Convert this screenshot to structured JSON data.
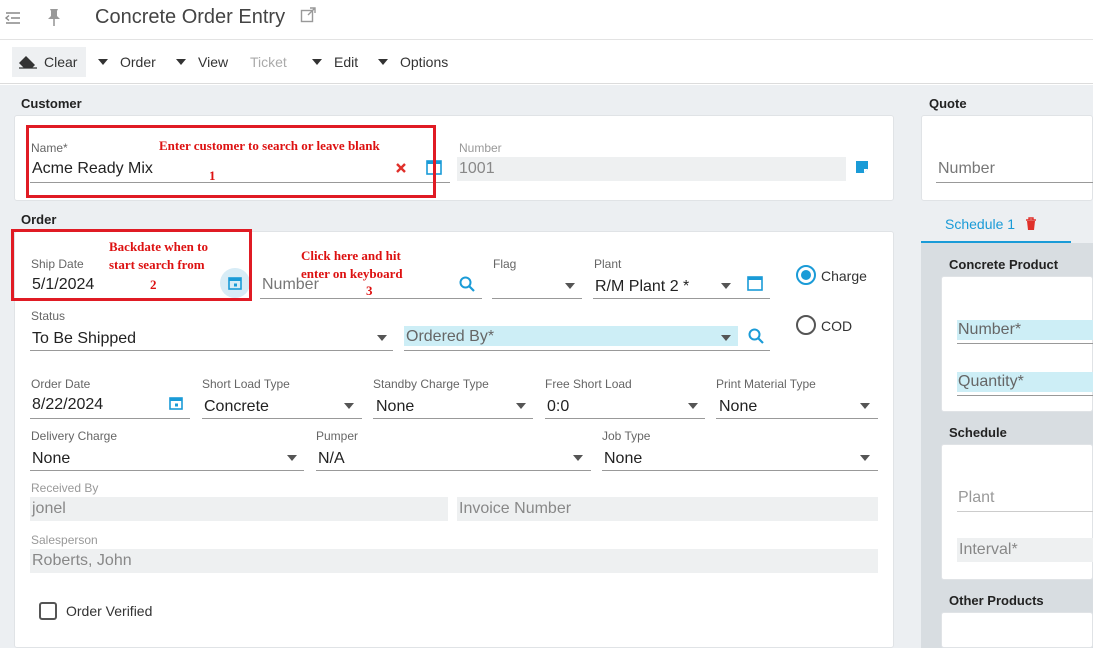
{
  "app": {
    "title": "Concrete Order Entry"
  },
  "toolbar": {
    "clear": "Clear",
    "order": "Order",
    "view": "View",
    "ticket": "Ticket",
    "edit": "Edit",
    "options": "Options"
  },
  "customer": {
    "section": "Customer",
    "name_label": "Name*",
    "name_value": "Acme Ready Mix",
    "number_label": "Number",
    "number_value": "1001"
  },
  "order": {
    "section": "Order",
    "ship_date_label": "Ship Date",
    "ship_date_value": "5/1/2024",
    "number_placeholder": "Number",
    "flag_label": "Flag",
    "plant_label": "Plant",
    "plant_value": "R/M Plant 2 *",
    "charge_label": "Charge",
    "cod_label": "COD",
    "status_label": "Status",
    "status_value": "To Be Shipped",
    "ordered_by_placeholder": "Ordered By*",
    "order_date_label": "Order Date",
    "order_date_value": "8/22/2024",
    "short_load_type_label": "Short Load Type",
    "short_load_type_value": "Concrete",
    "standby_charge_type_label": "Standby Charge Type",
    "standby_charge_type_value": "None",
    "free_short_load_label": "Free Short Load",
    "free_short_load_value": "0:0",
    "print_material_type_label": "Print Material Type",
    "print_material_type_value": "None",
    "delivery_charge_label": "Delivery Charge",
    "delivery_charge_value": "None",
    "pumper_label": "Pumper",
    "pumper_value": "N/A",
    "job_type_label": "Job Type",
    "job_type_value": "None",
    "received_by_label": "Received By",
    "received_by_value": "jonel",
    "invoice_number_placeholder": "Invoice Number",
    "salesperson_label": "Salesperson",
    "salesperson_value": "Roberts, John",
    "order_verified_label": "Order Verified"
  },
  "quote": {
    "section": "Quote",
    "number_placeholder": "Number"
  },
  "schedule_tab": {
    "tab_label": "Schedule 1",
    "concrete_product_section": "Concrete Product",
    "number_placeholder": "Number*",
    "quantity_placeholder": "Quantity*",
    "schedule_section": "Schedule",
    "plant_placeholder": "Plant",
    "interval_placeholder": "Interval*",
    "other_products_section": "Other Products"
  },
  "annotations": {
    "a1_text": "Enter customer to search or leave blank",
    "a1_num": "1",
    "a2_line1": "Backdate when to",
    "a2_line2": "start search from",
    "a2_num": "2",
    "a3_line1": "Click here and hit",
    "a3_line2": "enter on keyboard",
    "a3_num": "3"
  },
  "colors": {
    "accent": "#1a9bd7",
    "annotation_red": "#e01b24",
    "highlight": "#cdeef6"
  }
}
